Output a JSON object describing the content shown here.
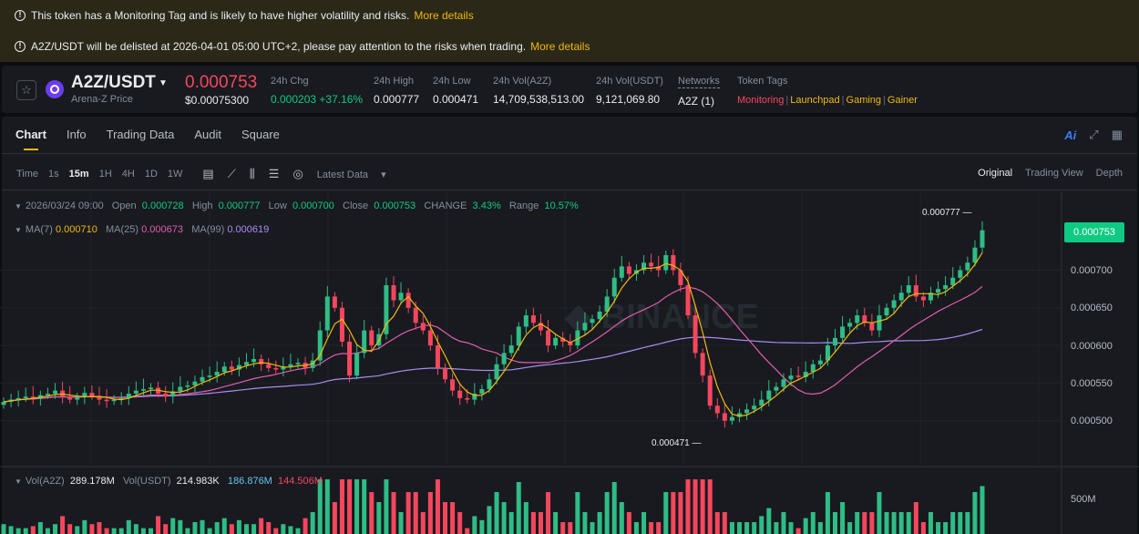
{
  "banners": {
    "first": {
      "text": "This token has a Monitoring Tag and is likely to have higher volatility and risks.",
      "link": "More details"
    },
    "second": {
      "text": "A2Z/USDT will be delisted at 2026-04-01 05:00 UTC+2, please pay attention to the risks when trading.",
      "link": "More details"
    }
  },
  "ticker": {
    "symbol": "A2Z/USDT",
    "subtitle": "Arena-Z Price",
    "price": "0.000753",
    "usd_price": "$0.00075300",
    "stats": [
      {
        "label": "24h Chg",
        "value": "0.000203 +37.16%"
      },
      {
        "label": "24h High",
        "value": "0.000777"
      },
      {
        "label": "24h Low",
        "value": "0.000471"
      },
      {
        "label": "24h Vol(A2Z)",
        "value": "14,709,538,513.00"
      },
      {
        "label": "24h Vol(USDT)",
        "value": "9,121,069.80"
      },
      {
        "label": "Networks",
        "value": "A2Z (1)"
      }
    ],
    "tags_label": "Token Tags",
    "tags": [
      "Monitoring",
      "Launchpad",
      "Gaming",
      "Gainer"
    ]
  },
  "tabs": [
    "Chart",
    "Info",
    "Trading Data",
    "Audit",
    "Square"
  ],
  "tool_right": {
    "ai": "Ai"
  },
  "toolbar": {
    "intervals": [
      "Time",
      "1s",
      "15m",
      "1H",
      "4H",
      "1D",
      "1W"
    ],
    "latest": "Latest Data",
    "views": [
      "Original",
      "Trading View",
      "Depth"
    ]
  },
  "ohlc": {
    "date": "2026/03/24 09:00",
    "open_label": "Open",
    "open": "0.000728",
    "high_label": "High",
    "high": "0.000777",
    "low_label": "Low",
    "low": "0.000700",
    "close_label": "Close",
    "close": "0.000753",
    "change_label": "CHANGE",
    "change": "3.43%",
    "range_label": "Range",
    "range": "10.57%"
  },
  "ma": {
    "ma7_label": "MA(7)",
    "ma7": "0.000710",
    "ma25_label": "MA(25)",
    "ma25": "0.000673",
    "ma99_label": "MA(99)",
    "ma99": "0.000619"
  },
  "vol": {
    "label_a2z": "Vol(A2Z)",
    "a2z": "289.178M",
    "label_usdt": "Vol(USDT)",
    "usdt": "214.983K",
    "v1": "186.876M",
    "v2": "144.506M",
    "axis": "500M"
  },
  "chart_data": {
    "type": "candlestick",
    "current_price": "0.000753",
    "high_marker": "0.000777",
    "low_marker": "0.000471",
    "y_ticks": [
      "0.000700",
      "0.000650",
      "0.000600",
      "0.000550",
      "0.000500"
    ],
    "y_values": [
      0.0007,
      0.00065,
      0.0006,
      0.00055,
      0.0005
    ],
    "close_series": [
      0.000525,
      0.000528,
      0.00053,
      0.000532,
      0.000529,
      0.000534,
      0.000536,
      0.00054,
      0.000532,
      0.000528,
      0.000531,
      0.000537,
      0.000533,
      0.000528,
      0.000526,
      0.000528,
      0.00053,
      0.000536,
      0.00054,
      0.000542,
      0.000544,
      0.000536,
      0.000532,
      0.000539,
      0.000545,
      0.000547,
      0.000552,
      0.000558,
      0.00056,
      0.000565,
      0.000572,
      0.000568,
      0.000574,
      0.000578,
      0.000582,
      0.000575,
      0.00057,
      0.000568,
      0.000572,
      0.000575,
      0.000577,
      0.00057,
      0.00058,
      0.00062,
      0.000665,
      0.00065,
      0.000605,
      0.00056,
      0.00059,
      0.00062,
      0.0006,
      0.000615,
      0.00068,
      0.00066,
      0.00067,
      0.00065,
      0.00063,
      0.00062,
      0.0006,
      0.00057,
      0.000555,
      0.00054,
      0.00053,
      0.000528,
      0.000536,
      0.000542,
      0.000555,
      0.000575,
      0.00059,
      0.0006,
      0.000625,
      0.00064,
      0.00063,
      0.00062,
      0.0006,
      0.00061,
      0.000605,
      0.0006,
      0.00062,
      0.00063,
      0.000635,
      0.000645,
      0.000665,
      0.00069,
      0.000705,
      0.000695,
      0.0007,
      0.00071,
      0.000705,
      0.0007,
      0.00072,
      0.0007,
      0.00068,
      0.00064,
      0.00059,
      0.00056,
      0.00052,
      0.00051,
      0.0005,
      0.000505,
      0.00051,
      0.000515,
      0.00052,
      0.000528,
      0.00054,
      0.000545,
      0.000555,
      0.00056,
      0.000558,
      0.000565,
      0.000575,
      0.00058,
      0.0006,
      0.00061,
      0.000625,
      0.00063,
      0.00064,
      0.00063,
      0.00062,
      0.00064,
      0.00065,
      0.00066,
      0.00067,
      0.00068,
      0.000665,
      0.00066,
      0.00067,
      0.000675,
      0.00068,
      0.00069,
      0.0007,
      0.00071,
      0.00073,
      0.000753
    ]
  }
}
